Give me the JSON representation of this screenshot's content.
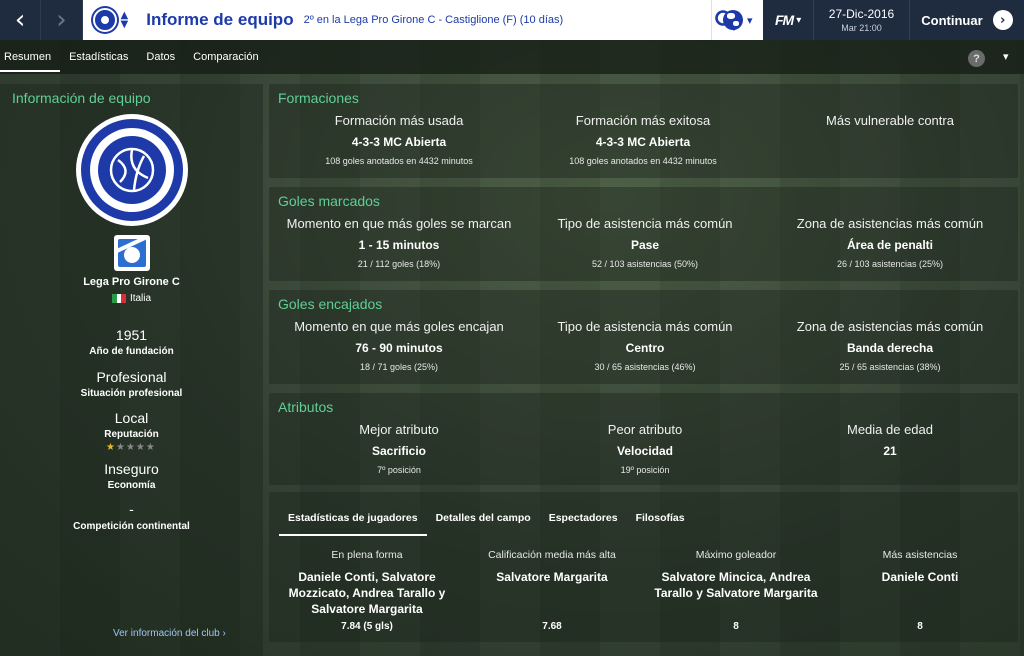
{
  "topbar": {
    "title": "Informe de equipo",
    "subtitle": "2º en la Lega Pro Girone C - Castiglione (F) (10 días)",
    "date": "27-Dic-2016",
    "time": "Mar 21:00",
    "continue_label": "Continuar",
    "fm_logo": "FM"
  },
  "tabs": [
    "Resumen",
    "Estadísticas",
    "Datos",
    "Comparación"
  ],
  "help": "?",
  "team_info": {
    "title": "Información de equipo",
    "league": "Lega Pro Girone C",
    "country": "Italia",
    "founded": "1951",
    "founded_label": "Año de fundación",
    "status": "Profesional",
    "status_label": "Situación profesional",
    "reputation": "Local",
    "reputation_label": "Reputación",
    "reputation_stars": 0.5,
    "economy": "Inseguro",
    "economy_label": "Economía",
    "continental": "-",
    "continental_label": "Competición continental",
    "club_link": "Ver información del club ›"
  },
  "formations": {
    "title": "Formaciones",
    "cols": [
      {
        "h": "Formación más usada",
        "v": "4-3-3 MC Abierta",
        "s": "108 goles anotados en 4432 minutos"
      },
      {
        "h": "Formación más exitosa",
        "v": "4-3-3 MC Abierta",
        "s": "108 goles anotados en 4432 minutos"
      },
      {
        "h": "Más vulnerable contra",
        "v": "",
        "s": ""
      }
    ]
  },
  "goals_scored": {
    "title": "Goles marcados",
    "cols": [
      {
        "h": "Momento en que más goles se marcan",
        "v": "1 - 15 minutos",
        "s": "21 / 112 goles (18%)"
      },
      {
        "h": "Tipo de asistencia más común",
        "v": "Pase",
        "s": "52 / 103 asistencias (50%)"
      },
      {
        "h": "Zona de asistencias más común",
        "v": "Área de penalti",
        "s": "26 / 103 asistencias (25%)"
      }
    ]
  },
  "goals_conceded": {
    "title": "Goles encajados",
    "cols": [
      {
        "h": "Momento en que más goles encajan",
        "v": "76 - 90 minutos",
        "s": "18 / 71 goles (25%)"
      },
      {
        "h": "Tipo de asistencia más común",
        "v": "Centro",
        "s": "30 / 65 asistencias (46%)"
      },
      {
        "h": "Zona de asistencias más común",
        "v": "Banda derecha",
        "s": "25 / 65 asistencias (38%)"
      }
    ]
  },
  "attributes": {
    "title": "Atributos",
    "cols": [
      {
        "h": "Mejor atributo",
        "v": "Sacrificio",
        "s": "7º posición"
      },
      {
        "h": "Peor atributo",
        "v": "Velocidad",
        "s": "19º posición"
      },
      {
        "h": "Media de edad",
        "v": "21",
        "s": ""
      }
    ]
  },
  "players": {
    "tabs": [
      "Estadísticas de jugadores",
      "Detalles del campo",
      "Espectadores",
      "Filosofías"
    ],
    "cols": [
      {
        "h": "En plena forma",
        "n": "Daniele Conti, Salvatore Mozzicato, Andrea Tarallo y Salvatore Margarita",
        "val": "7.84 (5 gls)"
      },
      {
        "h": "Calificación media más alta",
        "n": "Salvatore Margarita",
        "val": "7.68"
      },
      {
        "h": "Máximo goleador",
        "n": "Salvatore Mincica, Andrea Tarallo y Salvatore Margarita",
        "val": "8"
      },
      {
        "h": "Más asistencias",
        "n": "Daniele Conti",
        "val": "8"
      }
    ]
  },
  "colors": {
    "topbar": "#1f2b3f",
    "brand_blue": "#1d3aa8",
    "section_title": "#5fcf96",
    "link": "#9fc6f4"
  }
}
